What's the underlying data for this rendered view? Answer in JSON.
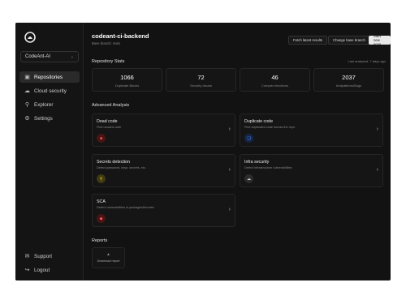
{
  "sidebar": {
    "org": "CodeAnt-AI",
    "items": [
      {
        "label": "Repositories",
        "icon": "repo-icon",
        "active": true
      },
      {
        "label": "Cloud security",
        "icon": "cloud-icon"
      },
      {
        "label": "Explorer",
        "icon": "search-icon"
      },
      {
        "label": "Settings",
        "icon": "gear-icon"
      }
    ],
    "bottom": [
      {
        "label": "Support",
        "icon": "support-icon"
      },
      {
        "label": "Logout",
        "icon": "logout-icon"
      }
    ]
  },
  "header": {
    "title": "codeant-ci-backend",
    "subtitle": "Base branch: main",
    "buttons": {
      "fetch": "Fetch latest results",
      "change": "Change base branch",
      "start": "Start new scan"
    }
  },
  "stats": {
    "title": "Repository Stats",
    "last_analysed": "Last analysed: 7 days ago",
    "items": [
      {
        "value": "1066",
        "label": "Duplicate Blocks"
      },
      {
        "value": "72",
        "label": "Security Issues"
      },
      {
        "value": "46",
        "label": "Complex functions"
      },
      {
        "value": "2037",
        "label": "Antipatterns/Bugs"
      }
    ]
  },
  "analysis": {
    "title": "Advanced Analysis",
    "cards": [
      {
        "title": "Dead code",
        "desc": "Find unused code",
        "icon": "trash-icon",
        "color": "#ff5a5a"
      },
      {
        "title": "Duplicate code",
        "desc": "Find duplicated code across the repo",
        "icon": "copy-icon",
        "color": "#5c8dff"
      },
      {
        "title": "Secrets detection",
        "desc": "Detect password, keys, secrets, etc.",
        "icon": "key-icon",
        "color": "#e5d54a"
      },
      {
        "title": "Infra security",
        "desc": "Detect Infrastructure vulnerabilities",
        "icon": "cloud-icon",
        "color": "#cfcfcf"
      },
      {
        "title": "SCA",
        "desc": "Detect vulnerabilities in packages/libraries",
        "icon": "shield-icon",
        "color": "#ff5a5a"
      }
    ]
  },
  "reports": {
    "title": "Reports",
    "download": "Download report"
  }
}
